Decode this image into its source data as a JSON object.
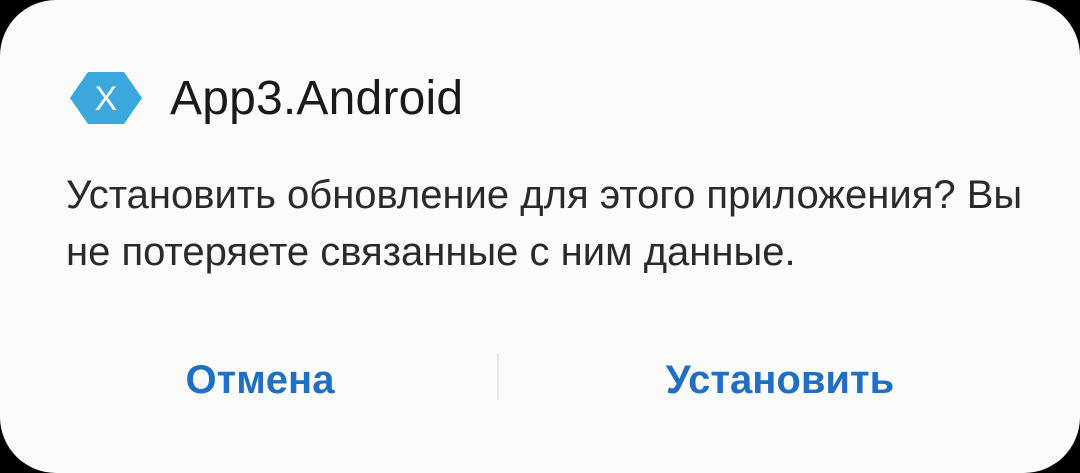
{
  "dialog": {
    "app_icon": {
      "name": "xamarin-logo-icon",
      "glyph": "X",
      "color": "#3498db"
    },
    "app_title": "App3.Android",
    "message": "Установить обновление для этого приложения? Вы не потеряете связанные с ним данные.",
    "buttons": {
      "cancel_label": "Отмена",
      "install_label": "Установить"
    },
    "accent_color": "#1f6fc5"
  }
}
